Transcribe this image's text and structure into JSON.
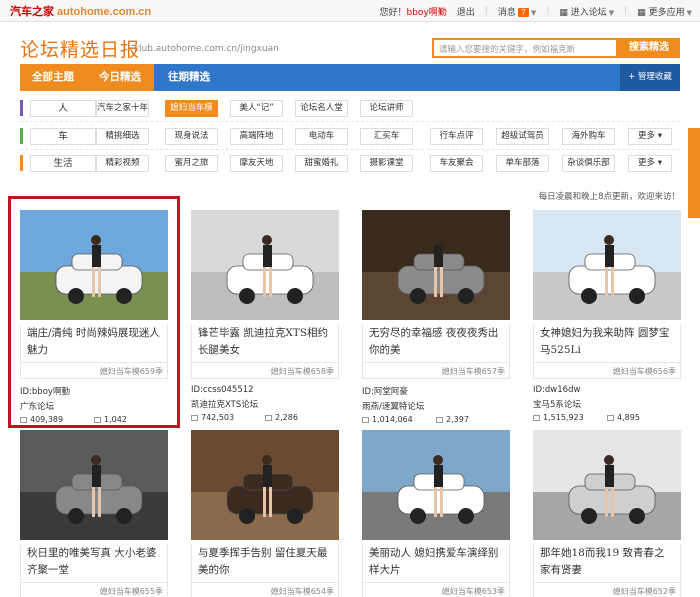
{
  "topbar": {
    "logo": "汽车之家",
    "logo_domain": "autohome.com.cn",
    "greeting": "您好！",
    "username": "bboy啊勤",
    "logout": "退出",
    "messages": "消息",
    "message_count": "7",
    "forum_link": "进入论坛",
    "more_apps": "更多应用"
  },
  "header": {
    "title": "论坛精选日报",
    "url": "club.autohome.com.cn/jingxuan",
    "search_placeholder": "请输入您要搜的关键字，例如福克斯",
    "search_button": "搜索精选"
  },
  "nav": {
    "tabs": [
      "全部主题",
      "今日精选",
      "往期精选"
    ],
    "favorite": "管理收藏"
  },
  "categories": [
    {
      "name": "人",
      "color": "#7a58b8",
      "tags": [
        "汽车之家十年",
        "媳妇当车模",
        "美人“记”",
        "论坛名人堂",
        "论坛讲师"
      ],
      "active": 1,
      "more": ""
    },
    {
      "name": "车",
      "color": "#5bb04e",
      "tags": [
        "精挑细选",
        "现身说法",
        "高端阵地",
        "电动车",
        "汇买车",
        "行车点评",
        "超级试驾员",
        "海外购车"
      ],
      "active": -1,
      "more": "更多"
    },
    {
      "name": "生活",
      "color": "#f08c1e",
      "tags": [
        "精彩视频",
        "蜜月之旅",
        "摩友天地",
        "甜蜜婚礼",
        "摄影课堂",
        "车友聚会",
        "单车部落",
        "杂谈俱乐部"
      ],
      "active": -1,
      "more": "更多"
    }
  ],
  "notice": "每日凌晨和晚上8点更新，欢迎来访！",
  "cards": [
    {
      "title": "端庄/清纯 时尚辣妈展现迷人魅力",
      "issue": "媳妇当车模659季",
      "author": "ID:bboy啊勤",
      "forum": "广东论坛",
      "views": "409,389",
      "replies": "1,042"
    },
    {
      "title": "锋芒毕露 凯迪拉克XTS相约长腿美女",
      "issue": "媳妇当车模658季",
      "author": "ID:ccss045512",
      "forum": "凯迪拉克XTS论坛",
      "views": "742,503",
      "replies": "2,286"
    },
    {
      "title": "无穷尽的幸福感 夜夜夜秀出你的美",
      "issue": "媳妇当车模657季",
      "author": "ID:阿堂阿豪",
      "forum": "雨燕/速翼特论坛",
      "views": "1,014,064",
      "replies": "2,397"
    },
    {
      "title": "女神媳妇为我来助阵 圆梦宝马525Li",
      "issue": "媳妇当车模656季",
      "author": "ID:dw16dw",
      "forum": "宝马5系论坛",
      "views": "1,515,923",
      "replies": "4,895"
    },
    {
      "title": "秋日里的唯美写真 大小老婆齐聚一堂",
      "issue": "媳妇当车模655季",
      "author": "",
      "forum": "",
      "views": "",
      "replies": ""
    },
    {
      "title": "与夏季挥手告别 留住夏天最美的你",
      "issue": "媳妇当车模654季",
      "author": "",
      "forum": "",
      "views": "",
      "replies": ""
    },
    {
      "title": "美丽动人 媳妇携爱车演绎别样大片",
      "issue": "媳妇当车模653季",
      "author": "",
      "forum": "",
      "views": "",
      "replies": ""
    },
    {
      "title": "那年她18而我19 致青春之家有贤妻",
      "issue": "媳妇当车模652季",
      "author": "",
      "forum": "",
      "views": "",
      "replies": ""
    }
  ],
  "colors": {
    "accent": "#f08c1e",
    "nav": "#2f77c8",
    "highlight": "#c0141e"
  }
}
